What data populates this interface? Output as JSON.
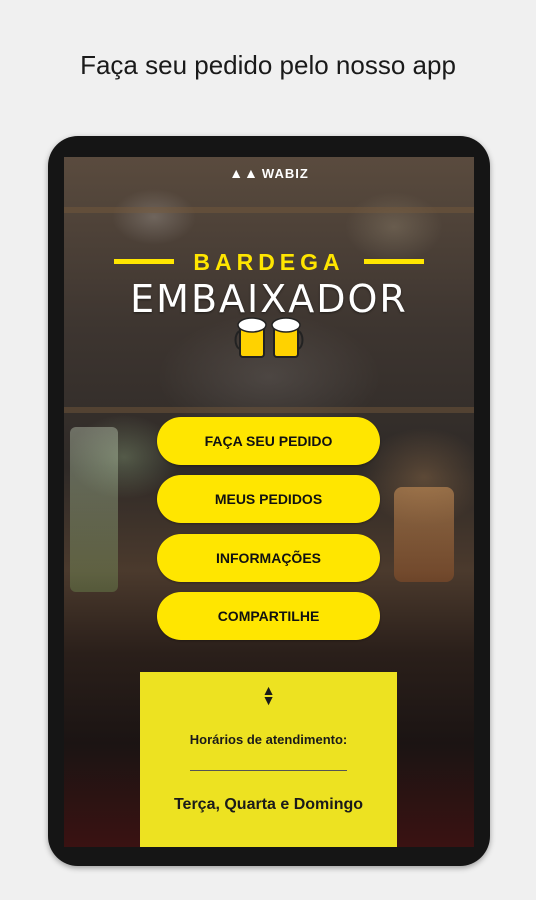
{
  "caption": "Faça seu pedido pelo nosso app",
  "brand": {
    "wabiz": "WABIZ"
  },
  "store": {
    "title_top": "BARDEGA",
    "title_main": "EMBAIXADOR"
  },
  "menu": {
    "order_label": "FAÇA SEU PEDIDO",
    "my_orders_label": "MEUS PEDIDOS",
    "info_label": "INFORMAÇÕES",
    "share_label": "COMPARTILHE"
  },
  "hours": {
    "label": "Horários de atendimento:",
    "days": "Terça, Quarta e Domingo"
  },
  "colors": {
    "accent": "#ffe600",
    "card": "#ede221"
  },
  "icons": {
    "beer": "beer-mugs-icon",
    "expand": "up-down-arrows-icon",
    "logo": "wabiz-logo-icon"
  }
}
